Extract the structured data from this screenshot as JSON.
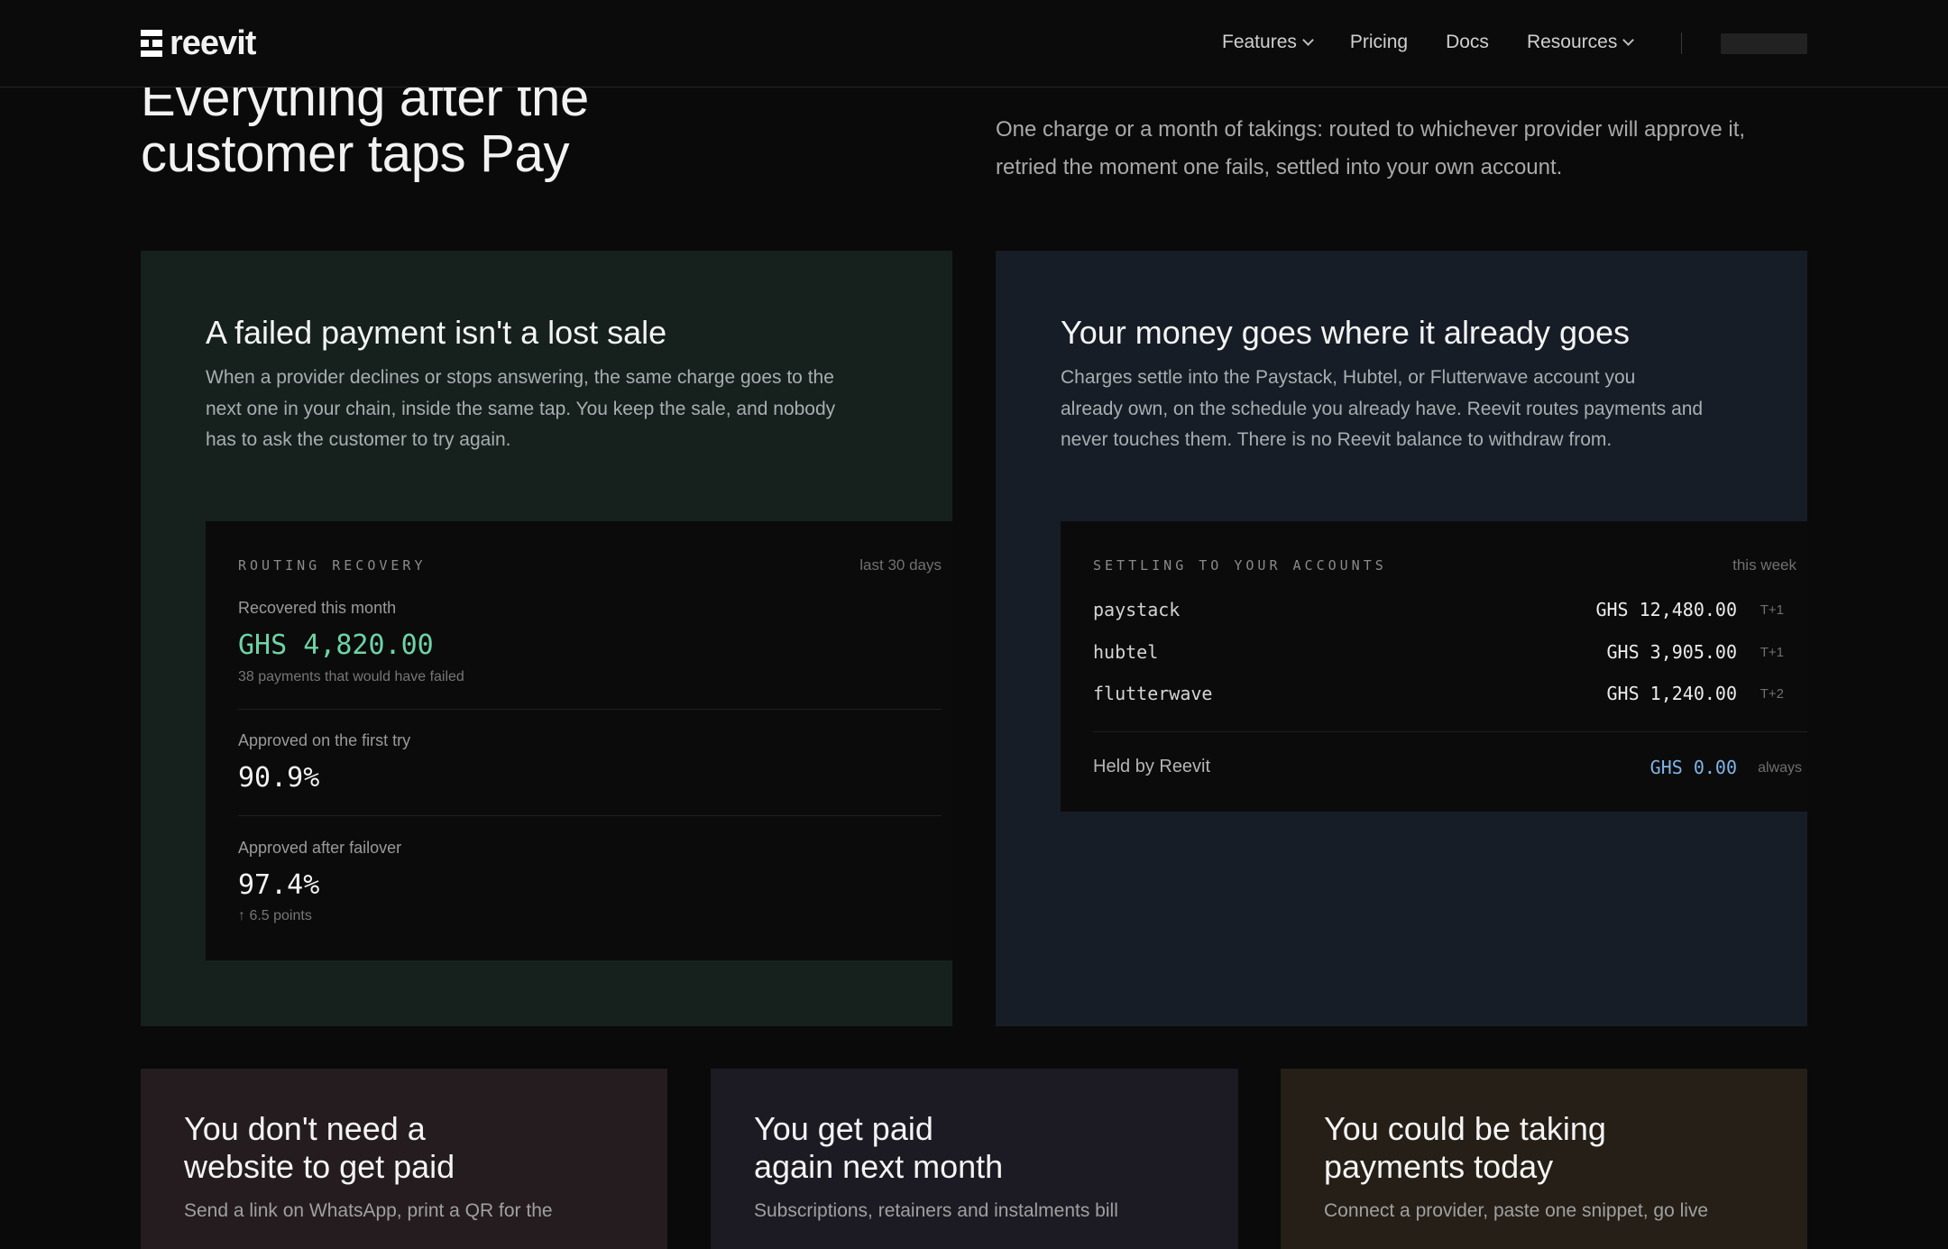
{
  "nav": {
    "brand": "reevit",
    "links": [
      {
        "label": "Features",
        "dropdown": true
      },
      {
        "label": "Pricing",
        "dropdown": false
      },
      {
        "label": "Docs",
        "dropdown": false
      },
      {
        "label": "Resources",
        "dropdown": true
      }
    ]
  },
  "hero": {
    "title_line1": "Everything after the",
    "title_line2": "customer taps Pay",
    "description_line1": "One charge or a month of takings: routed to whichever provider will approve it,",
    "description_line2": "retried the moment one fails, settled into your own account."
  },
  "card_recovery": {
    "title": "A failed payment isn't a lost sale",
    "desc_line1": "When a provider declines or stops answering, the same charge goes to the",
    "desc_line2": "next one in your chain, inside the same tap. You keep the sale, and nobody",
    "desc_line3": "has to ask the customer to try again.",
    "panel": {
      "label": "ROUTING RECOVERY",
      "period": "last 30 days",
      "recovered_label": "Recovered this month",
      "recovered_value": "GHS 4,820.00",
      "recovered_sub": "38 payments that would have failed",
      "first_try_label": "Approved on the first try",
      "first_try_value": "90.9%",
      "failover_label": "Approved after failover",
      "failover_value": "97.4%",
      "failover_delta": "↑ 6.5 points"
    }
  },
  "card_settlement": {
    "title": "Your money goes where it already goes",
    "desc_line1": "Charges settle into the Paystack, Hubtel, or Flutterwave account you",
    "desc_line2": "already own, on the schedule you already have. Reevit routes payments and",
    "desc_line3": "never touches them. There is no Reevit balance to withdraw from.",
    "panel": {
      "label": "SETTLING TO YOUR ACCOUNTS",
      "period": "this week",
      "rows": [
        {
          "provider": "paystack",
          "amount": "GHS 12,480.00",
          "term": "T+1"
        },
        {
          "provider": "hubtel",
          "amount": "GHS 3,905.00",
          "term": "T+1"
        },
        {
          "provider": "flutterwave",
          "amount": "GHS 1,240.00",
          "term": "T+2"
        }
      ],
      "held_label": "Held by Reevit",
      "held_value": "GHS 0.00",
      "held_term": "always"
    }
  },
  "bottom_cards": [
    {
      "title_line1": "You don't need a",
      "title_line2": "website to get paid",
      "desc": "Send a link on WhatsApp, print a QR for the"
    },
    {
      "title_line1": "You get paid",
      "title_line2": "again next month",
      "desc": "Subscriptions, retainers and instalments bill"
    },
    {
      "title_line1": "You could be taking",
      "title_line2": "payments today",
      "desc": "Connect a provider, paste one snippet, go live"
    }
  ],
  "colors": {
    "recovered_accent": "#6ed3a5",
    "held_accent": "#7fb5e8",
    "card_green": "#16211e",
    "card_blue": "#161d26"
  }
}
